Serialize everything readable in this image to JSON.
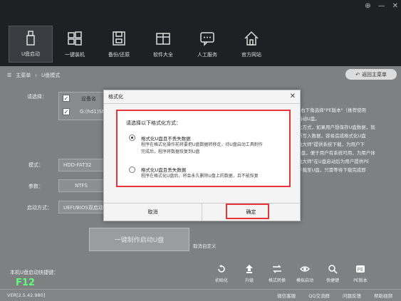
{
  "window": {
    "controls": [
      "⊕",
      "—",
      "✕"
    ]
  },
  "tabs": [
    {
      "label": "U盘启动",
      "icon": "usb-drive-icon",
      "active": true
    },
    {
      "label": "一键装机",
      "icon": "windows-logo-icon",
      "active": false
    },
    {
      "label": "备份/还原",
      "icon": "backup-restore-icon",
      "active": false
    },
    {
      "label": "软件大全",
      "icon": "software-box-icon",
      "active": false
    },
    {
      "label": "人工服务",
      "icon": "chat-bubble-icon",
      "active": false
    },
    {
      "label": "官方网站",
      "icon": "home-icon",
      "active": false
    }
  ],
  "breadcrumb": {
    "home": "主菜单",
    "current": "U盘模式"
  },
  "back_button": "返回主菜单",
  "form": {
    "select_label": "请选择：",
    "device_col": "设备名",
    "device_row": "G:(hd1)SM",
    "mode_label": "模式：",
    "mode_value": "HDD-FAT32",
    "param_label": "参数：",
    "param_value": "NTFS",
    "boot_label": "启动方式：",
    "boot_value": "UEFI/BIOS双启动"
  },
  "right_notes": ", 右下角选择\"PE版本\"（推荐使用\n启动U盘。\n化方式，如果用户想保存U盘数据，就\n新写入数据，容易造成格式化U盘\n桃大师\"提供系统下载，为用户下\nU盘，便于用户有系统可用，为用户体\n桃大师\"在U盘启动后为用户提供PE\n下载至U盘，只需等待下载完成即",
  "big_button": "一键制作启动U盘",
  "cancel_custom": "取消自定义",
  "hotkey": {
    "label": "本机U盘启动快捷键：",
    "key": "F12"
  },
  "tools": [
    {
      "label": "初始化",
      "icon": "reset-icon"
    },
    {
      "label": "升级",
      "icon": "upgrade-icon"
    },
    {
      "label": "格式转换",
      "icon": "convert-icon"
    },
    {
      "label": "模拟启动",
      "icon": "eye-icon"
    },
    {
      "label": "快捷键",
      "icon": "search-icon"
    },
    {
      "label": "PE版本",
      "icon": "pe-icon"
    }
  ],
  "status": {
    "version": "VER[2.5.42.980]",
    "links": [
      "微信客服",
      "QQ交流群",
      "问题反馈",
      "帮助视频"
    ]
  },
  "dialog": {
    "title": "格式化",
    "close": "✕",
    "prompt": "请选择以下格式化方式：",
    "option1_title": "格式化U盘且不丢失数据",
    "option1_desc_1": "程序在格式化操作前将要把U盘数据转移走，待U盘启动工具制作",
    "option1_desc_2": "完成后，程序将数据恢复到U盘",
    "option2_title": "格式化U盘且丢失数据",
    "option2_desc": "程序在格式化U盘后，将会永久删除U盘上的数据，且不能恢复",
    "cancel": "取消",
    "ok": "确定"
  }
}
